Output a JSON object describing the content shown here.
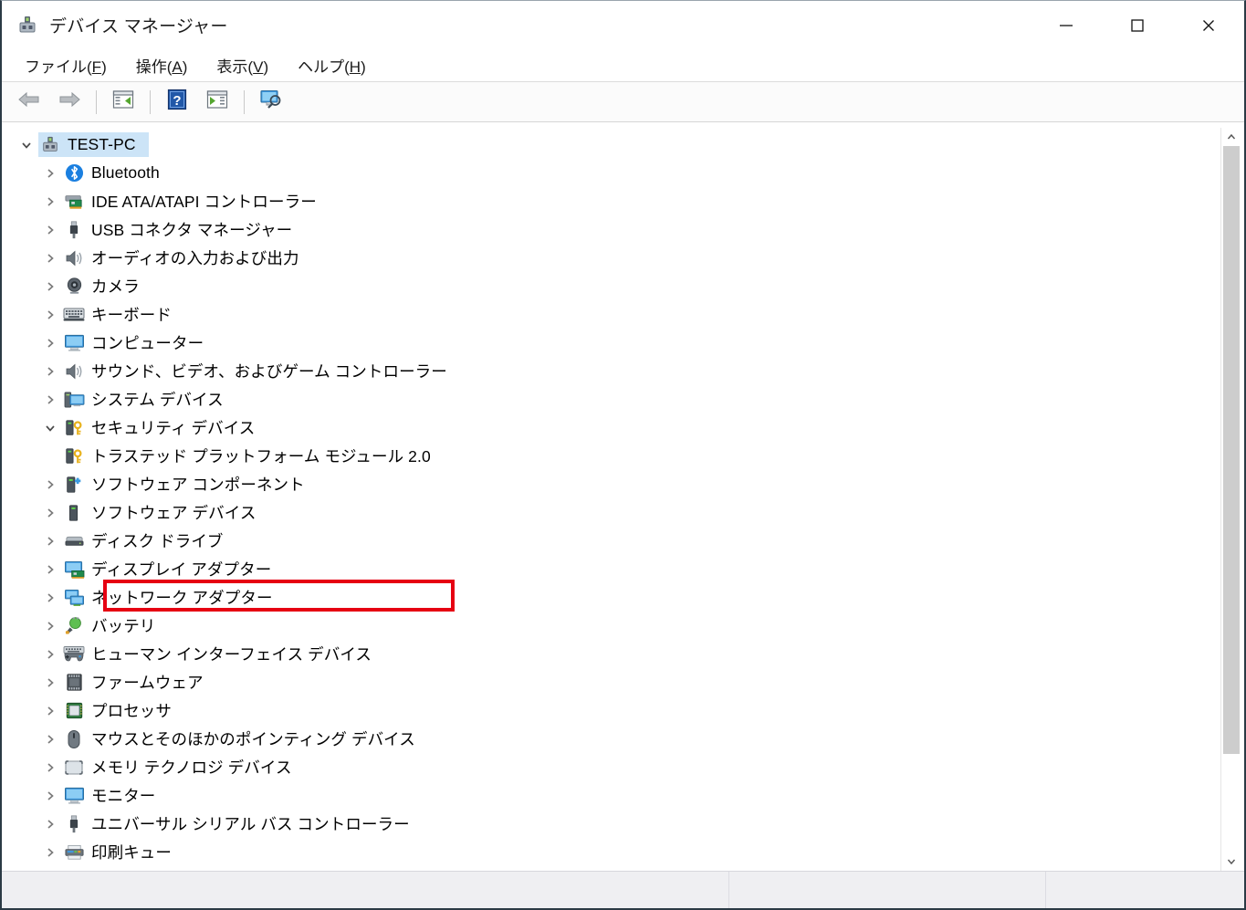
{
  "window": {
    "title": "デバイス マネージャー",
    "title_icon": "device-manager-icon",
    "controls": {
      "minimize": "minimize-icon",
      "maximize": "maximize-icon",
      "close": "close-icon"
    }
  },
  "menubar": {
    "items": [
      {
        "label": "ファイル",
        "accel": "F"
      },
      {
        "label": "操作",
        "accel": "A"
      },
      {
        "label": "表示",
        "accel": "V"
      },
      {
        "label": "ヘルプ",
        "accel": "H"
      }
    ]
  },
  "toolbar": {
    "buttons": [
      {
        "name": "back-button",
        "icon": "left-arrow-icon"
      },
      {
        "name": "forward-button",
        "icon": "right-arrow-icon"
      },
      {
        "name": "properties-button",
        "icon": "properties-window-icon"
      },
      {
        "name": "help-button",
        "icon": "blue-question-mark-icon"
      },
      {
        "name": "update-driver-button",
        "icon": "window-play-icon"
      },
      {
        "name": "scan-hardware-changes-button",
        "icon": "monitor-magnifier-icon"
      }
    ]
  },
  "tree": {
    "root": {
      "label": "TEST-PC",
      "icon": "computer-device-icon",
      "expanded": true,
      "selected": true
    },
    "items": [
      {
        "label": "Bluetooth",
        "icon": "bluetooth-icon",
        "expanded": false,
        "level": 1
      },
      {
        "label": "IDE ATA/ATAPI コントローラー",
        "icon": "ide-controller-icon",
        "expanded": false,
        "level": 1
      },
      {
        "label": "USB コネクタ マネージャー",
        "icon": "usb-connector-icon",
        "expanded": false,
        "level": 1
      },
      {
        "label": "オーディオの入力および出力",
        "icon": "speaker-icon",
        "expanded": false,
        "level": 1
      },
      {
        "label": "カメラ",
        "icon": "camera-icon",
        "expanded": false,
        "level": 1
      },
      {
        "label": "キーボード",
        "icon": "keyboard-icon",
        "expanded": false,
        "level": 1
      },
      {
        "label": "コンピューター",
        "icon": "monitor-icon",
        "expanded": false,
        "level": 1
      },
      {
        "label": "サウンド、ビデオ、およびゲーム コントローラー",
        "icon": "speaker-icon",
        "expanded": false,
        "level": 1
      },
      {
        "label": "システム デバイス",
        "icon": "system-devices-icon",
        "expanded": false,
        "level": 1
      },
      {
        "label": "セキュリティ デバイス",
        "icon": "security-device-key-icon",
        "expanded": true,
        "level": 1
      },
      {
        "label": "トラステッド プラットフォーム モジュール 2.0",
        "icon": "security-device-key-icon",
        "expanded": null,
        "level": 2,
        "highlighted": true
      },
      {
        "label": "ソフトウェア コンポーネント",
        "icon": "software-component-icon",
        "expanded": false,
        "level": 1
      },
      {
        "label": "ソフトウェア デバイス",
        "icon": "software-device-icon",
        "expanded": false,
        "level": 1
      },
      {
        "label": "ディスク ドライブ",
        "icon": "disk-drive-icon",
        "expanded": false,
        "level": 1
      },
      {
        "label": "ディスプレイ アダプター",
        "icon": "display-adapter-icon",
        "expanded": false,
        "level": 1
      },
      {
        "label": "ネットワーク アダプター",
        "icon": "network-adapter-icon",
        "expanded": false,
        "level": 1
      },
      {
        "label": "バッテリ",
        "icon": "battery-icon",
        "expanded": false,
        "level": 1
      },
      {
        "label": "ヒューマン インターフェイス デバイス",
        "icon": "hid-icon",
        "expanded": false,
        "level": 1
      },
      {
        "label": "ファームウェア",
        "icon": "firmware-chip-icon",
        "expanded": false,
        "level": 1
      },
      {
        "label": "プロセッサ",
        "icon": "processor-icon",
        "expanded": false,
        "level": 1
      },
      {
        "label": "マウスとそのほかのポインティング デバイス",
        "icon": "mouse-icon",
        "expanded": false,
        "level": 1
      },
      {
        "label": "メモリ テクノロジ デバイス",
        "icon": "memory-technology-icon",
        "expanded": false,
        "level": 1
      },
      {
        "label": "モニター",
        "icon": "monitor-icon",
        "expanded": false,
        "level": 1
      },
      {
        "label": "ユニバーサル シリアル バス コントローラー",
        "icon": "usb-controller-icon",
        "expanded": false,
        "level": 1
      },
      {
        "label": "印刷キュー",
        "icon": "print-queue-icon",
        "expanded": false,
        "level": 1,
        "clipped": true
      }
    ]
  },
  "annotation": {
    "color": "#e60012",
    "target_label": "トラステッド プラットフォーム モジュール 2.0"
  },
  "scrollbar": {
    "up_icon": "chevron-up-icon",
    "down_icon": "chevron-down-icon",
    "thumb_position_percent": 0,
    "thumb_size_percent": 86
  },
  "statusbar": {
    "cells": [
      "",
      "",
      ""
    ]
  }
}
